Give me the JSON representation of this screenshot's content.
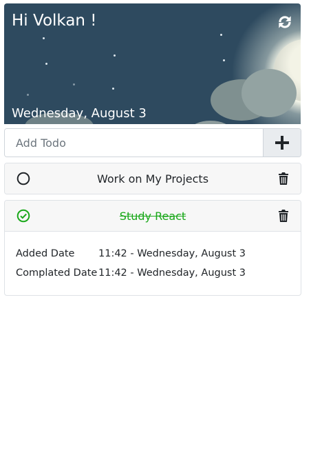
{
  "header": {
    "greeting": "Hi Volkan !",
    "date": "Wednesday, August 3",
    "refresh_icon": "sync-icon"
  },
  "add_todo": {
    "placeholder": "Add Todo",
    "value": "",
    "button_icon": "plus-icon"
  },
  "todos": [
    {
      "title": "Work on My Projects",
      "completed": false,
      "status_icon": "circle-icon",
      "delete_icon": "trash-icon"
    },
    {
      "title": "Study React",
      "completed": true,
      "status_icon": "check-circle-icon",
      "delete_icon": "trash-icon",
      "details": [
        {
          "label": "Added Date",
          "value": "11:42 - Wednesday, August 3"
        },
        {
          "label": "Complated Date",
          "value": "11:42 - Wednesday, August 3"
        }
      ]
    }
  ],
  "colors": {
    "hero_bg": "#2e4a5f",
    "completed": "#1aa81a"
  }
}
